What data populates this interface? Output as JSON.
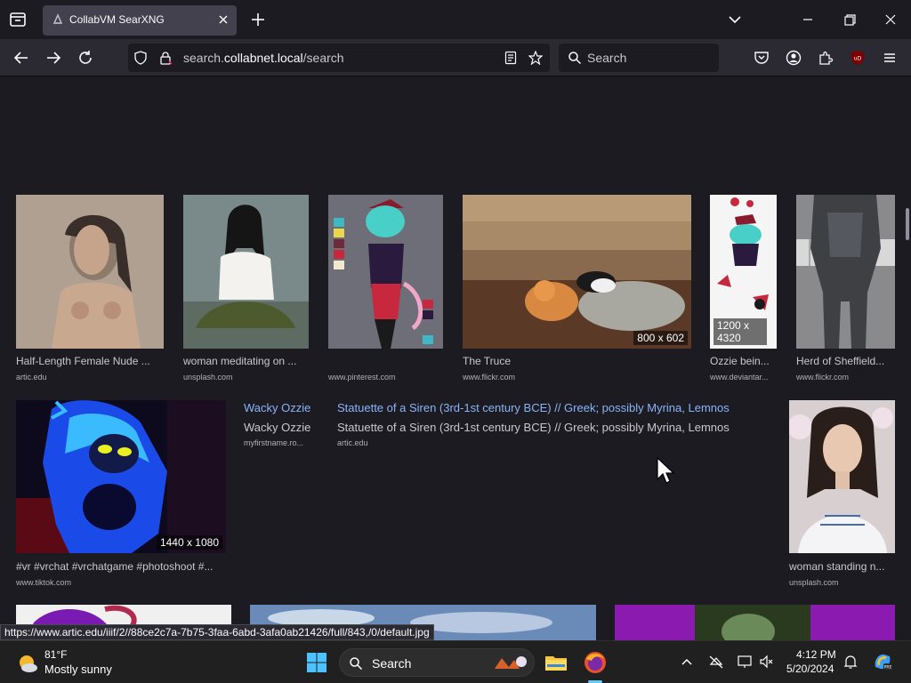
{
  "browser": {
    "tab_title": "CollabVM SearXNG",
    "url_prefix": "search.",
    "url_domain": "collabnet.local",
    "url_path": "/search",
    "search_placeholder": "Search",
    "status_url": "https://www.artic.edu/iiif/2//88ce2c7a-7b75-3faa-6abd-3afa0ab21426/full/843,/0/default.jpg"
  },
  "results_row1": [
    {
      "title": "Half-Length Female Nude ...",
      "source": "artic.edu",
      "res": ""
    },
    {
      "title": "woman meditating on ...",
      "source": "unsplash.com",
      "res": ""
    },
    {
      "title": "",
      "source": "www.pinterest.com",
      "res": ""
    },
    {
      "title": "The Truce",
      "source": "www.flickr.com",
      "res": "800 x 602"
    },
    {
      "title": "Ozzie bein...",
      "source": "www.deviantar...",
      "res": "1200 x 4320"
    },
    {
      "title": "Herd of Sheffield...",
      "source": "www.flickr.com",
      "res": ""
    }
  ],
  "results_row2": {
    "vr": {
      "title": "#vr #vrchat #vrchatgame #photoshoot #...",
      "source": "www.tiktok.com",
      "res": "1440 x 1080"
    },
    "wacky": {
      "link": "Wacky Ozzie",
      "title": "Wacky Ozzie",
      "source": "myfirstname.ro..."
    },
    "siren": {
      "link": "Statuette of a Siren (3rd-1st century BCE) // Greek; possibly Myrina, Lemnos",
      "title": "Statuette of a Siren (3rd-1st century BCE) // Greek; possibly Myrina, Lemnos",
      "source": "artic.edu"
    },
    "woman": {
      "title": "woman standing n...",
      "source": "unsplash.com"
    }
  },
  "taskbar": {
    "temp": "81°F",
    "weather": "Mostly sunny",
    "search_label": "Search",
    "time": "4:12 PM",
    "date": "5/20/2024"
  },
  "icons": [
    "tab-list-icon",
    "close-icon",
    "plus-icon",
    "chevron-down-icon",
    "minimize-icon",
    "restore-icon",
    "window-close-icon",
    "back-icon",
    "forward-icon",
    "reload-icon",
    "shield-icon",
    "lock-icon",
    "reader-icon",
    "star-icon",
    "search-icon",
    "pocket-icon",
    "account-icon",
    "extensions-icon",
    "ublock-icon",
    "menu-icon",
    "weather-icon",
    "windows-start-icon",
    "file-explorer-icon",
    "firefox-icon",
    "chevron-up-icon",
    "network-icon",
    "display-icon",
    "bell-icon",
    "copilot-icon"
  ]
}
